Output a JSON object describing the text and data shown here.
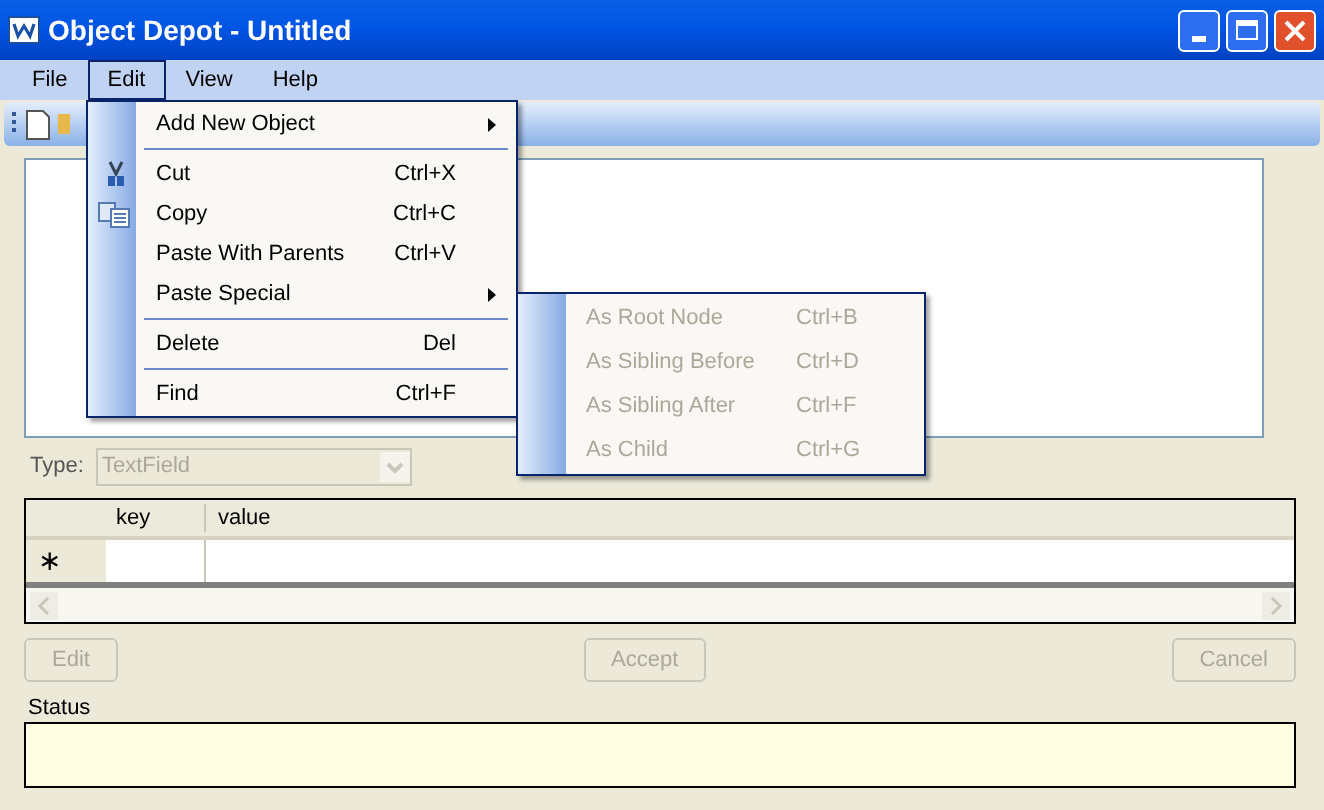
{
  "window": {
    "title": "Object Depot - Untitled"
  },
  "menubar": [
    {
      "label": "File",
      "selected": false
    },
    {
      "label": "Edit",
      "selected": true
    },
    {
      "label": "View",
      "selected": false
    },
    {
      "label": "Help",
      "selected": false
    }
  ],
  "edit_menu": [
    {
      "kind": "item",
      "label": "Add New Object",
      "submenu": true
    },
    {
      "kind": "separator"
    },
    {
      "kind": "cut",
      "label": "Cut",
      "shortcut": "Ctrl+X",
      "submenu": false
    },
    {
      "kind": "copy",
      "label": "Copy",
      "shortcut": "Ctrl+C",
      "submenu": false
    },
    {
      "kind": "item",
      "label": "Paste With Parents",
      "shortcut": "Ctrl+V",
      "submenu": false
    },
    {
      "kind": "item",
      "label": "Paste Special",
      "submenu": true
    },
    {
      "kind": "separator"
    },
    {
      "kind": "item",
      "label": "Delete",
      "shortcut": "Del",
      "submenu": false
    },
    {
      "kind": "separator"
    },
    {
      "kind": "item",
      "label": "Find",
      "shortcut": "Ctrl+F",
      "submenu": false
    }
  ],
  "paste_special_menu": [
    {
      "label": "As Root Node",
      "shortcut": "Ctrl+B",
      "disabled": true
    },
    {
      "label": "As Sibling Before",
      "shortcut": "Ctrl+D",
      "disabled": true
    },
    {
      "label": "As Sibling After",
      "shortcut": "Ctrl+F",
      "disabled": true
    },
    {
      "label": "As Child",
      "shortcut": "Ctrl+G",
      "disabled": true
    }
  ],
  "type_field": {
    "label": "Type:",
    "value": "TextField",
    "disabled": true
  },
  "table": {
    "columns": [
      "key",
      "value"
    ],
    "new_row_marker": "∗"
  },
  "buttons": [
    {
      "label": "Edit",
      "disabled": true
    },
    {
      "label": "Accept",
      "disabled": true
    },
    {
      "label": "Cancel",
      "disabled": true
    }
  ],
  "status": {
    "label": "Status"
  }
}
